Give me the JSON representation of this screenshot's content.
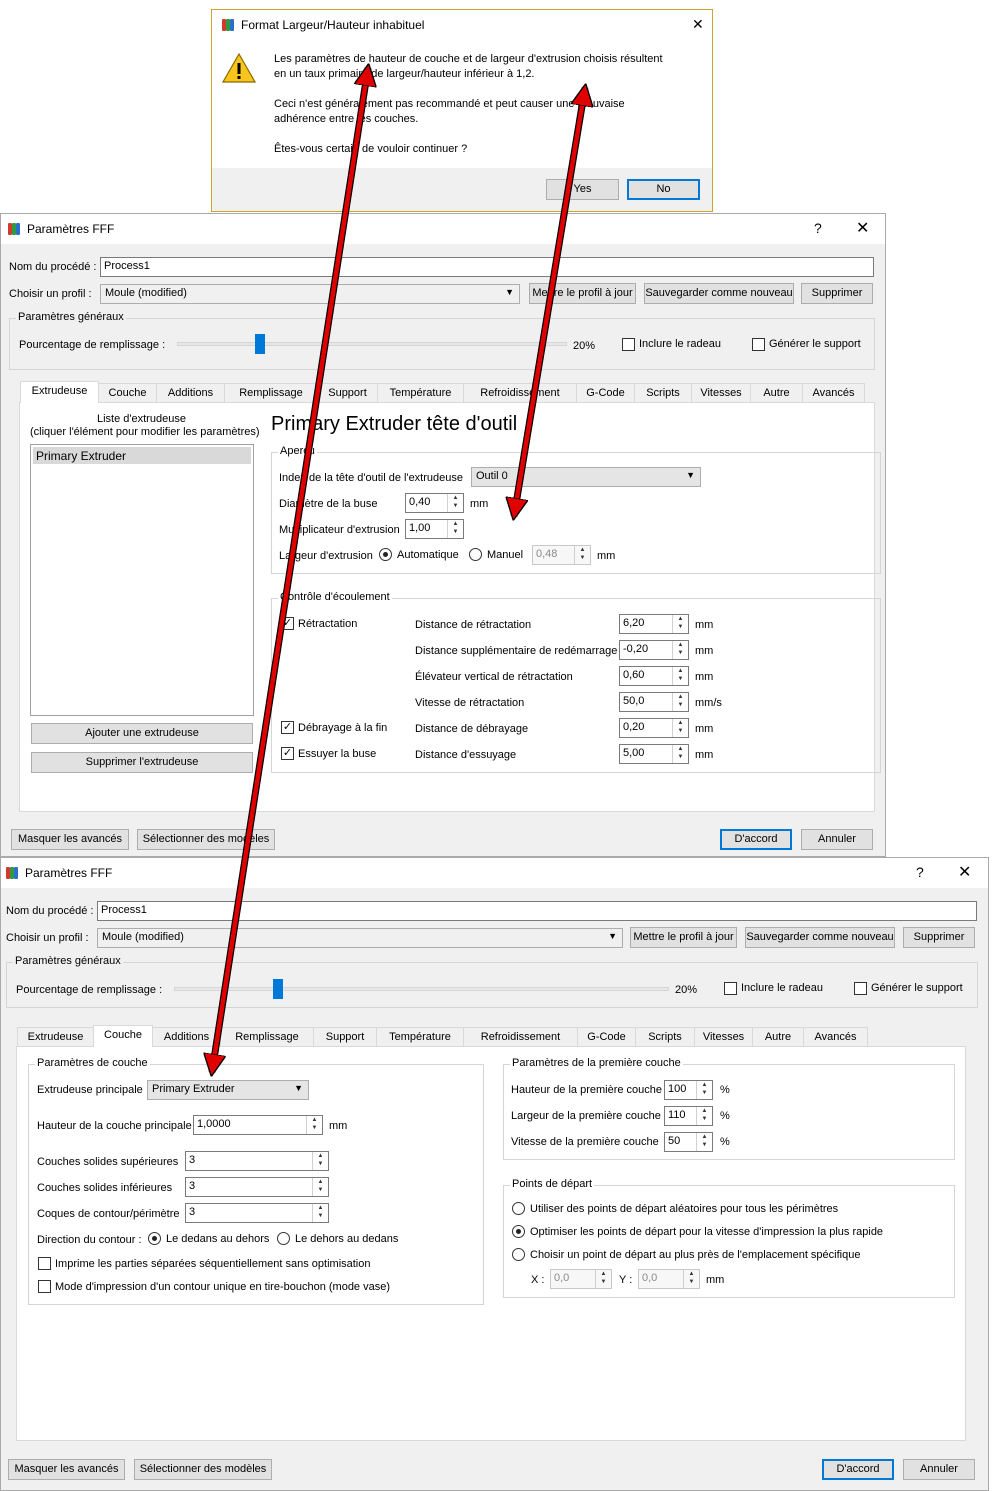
{
  "alert": {
    "title": "Format Largeur/Hauteur inhabituel",
    "line1": "Les paramètres de hauteur de couche et de largeur d'extrusion choisis résultent",
    "line2": "en un taux primaire de largeur/hauteur inférieur à 1,2.",
    "line3": "Ceci n'est généralement pas recommandé et peut causer une mauvaise",
    "line4": "adhérence entre les couches.",
    "line5": "Êtes-vous certain de vouloir continuer ?",
    "yes": "Yes",
    "no": "No",
    "close": "✕",
    "icon": "warning-icon"
  },
  "dialog1": {
    "title": "Paramètres FFF",
    "help": "?",
    "close": "✕",
    "process_label": "Nom du procédé :",
    "process_value": "Process1",
    "profile_label": "Choisir un profil :",
    "profile_value": "Moule (modified)",
    "update_profile": "Mettre le profil à jour",
    "save_new": "Sauvegarder comme nouveau",
    "delete": "Supprimer",
    "general_group": "Paramètres généraux",
    "infill_label": "Pourcentage de remplissage :",
    "infill_value": "20%",
    "infill_fraction": 0.2,
    "raft": "Inclure le radeau",
    "support": "Générer le support",
    "tabs": [
      "Extrudeuse",
      "Couche",
      "Additions",
      "Remplissage",
      "Support",
      "Température",
      "Refroidissement",
      "G-Code",
      "Scripts",
      "Vitesses",
      "Autre",
      "Avancés"
    ],
    "selected_tab": 0,
    "list_title1": "Liste d'extrudeuse",
    "list_title2": "(cliquer l'élément pour modifier les paramètres)",
    "list_item": "Primary Extruder",
    "add_extruder": "Ajouter une extrudeuse",
    "remove_extruder": "Supprimer l'extrudeuse",
    "extruder_heading": "Primary Extruder tête d'outil",
    "overview_group": "Aperçu",
    "tool_index_label": "Index de la tête d'outil de l'extrudeuse",
    "tool_index_value": "Outil 0",
    "nozzle_label": "Diamètre de la buse",
    "nozzle_value": "0,40",
    "mm": "mm",
    "mult_label": "Multiplicateur d'extrusion",
    "mult_value": "1,00",
    "width_label": "Largeur d'extrusion",
    "auto": "Automatique",
    "manual": "Manuel",
    "width_value": "0,48",
    "flow_group": "Contrôle d'écoulement",
    "retraction": "Rétractation",
    "retract_dist_label": "Distance de rétractation",
    "retract_dist_value": "6,20",
    "extra_restart_label": "Distance supplémentaire de redémarrage",
    "extra_restart_value": "-0,20",
    "zlift_label": "Élévateur vertical de rétractation",
    "zlift_value": "0,60",
    "retract_speed_label": "Vitesse de rétractation",
    "retract_speed_value": "50,0",
    "mms": "mm/s",
    "coast": "Débrayage à la fin",
    "coast_dist_label": "Distance de débrayage",
    "coast_dist_value": "0,20",
    "wipe": "Essuyer la buse",
    "wipe_dist_label": "Distance d'essuyage",
    "wipe_dist_value": "5,00",
    "hide_advanced": "Masquer les avancés",
    "select_models": "Sélectionner des modèles",
    "ok": "D'accord",
    "cancel": "Annuler"
  },
  "dialog2": {
    "title": "Paramètres FFF",
    "help": "?",
    "close": "✕",
    "process_label": "Nom du procédé :",
    "process_value": "Process1",
    "profile_label": "Choisir un profil :",
    "profile_value": "Moule (modified)",
    "update_profile": "Mettre le profil à jour",
    "save_new": "Sauvegarder comme nouveau",
    "delete": "Supprimer",
    "general_group": "Paramètres généraux",
    "infill_label": "Pourcentage de remplissage :",
    "infill_value": "20%",
    "infill_fraction": 0.2,
    "raft": "Inclure le radeau",
    "support": "Générer le support",
    "tabs": [
      "Extrudeuse",
      "Couche",
      "Additions",
      "Remplissage",
      "Support",
      "Température",
      "Refroidissement",
      "G-Code",
      "Scripts",
      "Vitesses",
      "Autre",
      "Avancés"
    ],
    "selected_tab": 1,
    "layer_group": "Paramètres de couche",
    "primary_extruder_label": "Extrudeuse principale",
    "primary_extruder_value": "Primary Extruder",
    "layer_height_label": "Hauteur de la couche principale",
    "layer_height_value": "1,0000",
    "mm": "mm",
    "top_layers_label": "Couches solides supérieures",
    "top_layers_value": "3",
    "bottom_layers_label": "Couches solides inférieures",
    "bottom_layers_value": "3",
    "perimeters_label": "Coques de contour/périmètre",
    "perimeters_value": "3",
    "outline_dir_label": "Direction du contour :",
    "inside_out": "Le dedans au dehors",
    "outside_in": "Le dehors au dedans",
    "print_islands": "Imprime les parties séparées séquentiellement sans optimisation",
    "vase_mode": "Mode d'impression d'un contour unique en tire-bouchon (mode vase)",
    "first_layer_group": "Paramètres de la première couche",
    "first_height_label": "Hauteur de la première couche",
    "first_height_value": "100",
    "first_width_label": "Largeur de la première couche",
    "first_width_value": "110",
    "first_speed_label": "Vitesse de la première couche",
    "first_speed_value": "50",
    "pct": "%",
    "start_group": "Points de départ",
    "start_random": "Utiliser des points de départ aléatoires pour tous les périmètres",
    "start_optimize": "Optimiser les points de départ pour la vitesse d'impression la plus rapide",
    "start_specific": "Choisir un point de départ au plus près de l'emplacement spécifique",
    "x_label": "X :",
    "x_value": "0,0",
    "y_label": "Y :",
    "y_value": "0,0",
    "hide_advanced": "Masquer les avancés",
    "select_models": "Sélectionner des modèles",
    "ok": "D'accord",
    "cancel": "Annuler"
  }
}
